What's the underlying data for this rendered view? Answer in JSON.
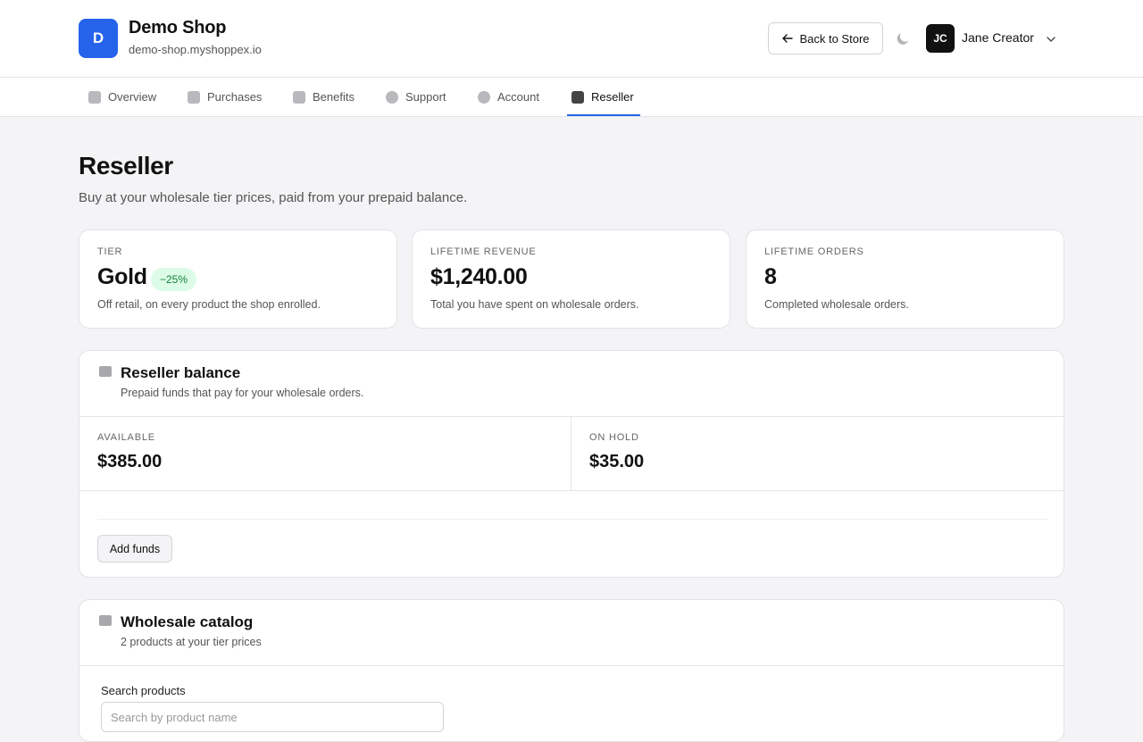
{
  "header": {
    "logo_letter": "D",
    "shop_name": "Demo Shop",
    "shop_domain": "demo-shop.myshoppex.io",
    "back_label": "Back to Store",
    "avatar_initials": "JC",
    "user_name": "Jane Creator",
    "brand_color": "#2563eb"
  },
  "tabs": [
    {
      "label": "Overview",
      "icon": "home-icon"
    },
    {
      "label": "Purchases",
      "icon": "bag-icon"
    },
    {
      "label": "Benefits",
      "icon": "gift-icon"
    },
    {
      "label": "Support",
      "icon": "chat-icon"
    },
    {
      "label": "Account",
      "icon": "user-icon"
    },
    {
      "label": "Reseller",
      "icon": "reseller-icon",
      "active": true
    }
  ],
  "page": {
    "title": "Reseller",
    "subtitle": "Buy at your wholesale tier prices, paid from your prepaid balance."
  },
  "stats": {
    "tier": {
      "label": "TIER",
      "value": "Gold",
      "badge": "−25%",
      "desc": "Off retail, on every product the shop enrolled."
    },
    "revenue": {
      "label": "LIFETIME REVENUE",
      "value": "$1,240.00",
      "desc": "Total you have spent on wholesale orders."
    },
    "orders": {
      "label": "LIFETIME ORDERS",
      "value": "8",
      "desc": "Completed wholesale orders."
    }
  },
  "balance": {
    "title": "Reseller balance",
    "subtitle": "Prepaid funds that pay for your wholesale orders.",
    "available_label": "AVAILABLE",
    "available_value": "$385.00",
    "hold_label": "ON HOLD",
    "hold_value": "$35.00",
    "add_funds_label": "Add funds"
  },
  "catalog": {
    "title": "Wholesale catalog",
    "subtitle": "2 products at your tier prices",
    "search_label": "Search products",
    "search_placeholder": "Search by product name"
  }
}
